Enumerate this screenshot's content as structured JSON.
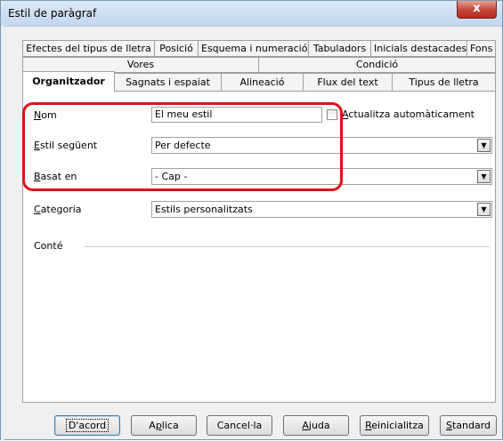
{
  "window": {
    "title": "Estil de paràgraf",
    "close_label": "x"
  },
  "tabs": {
    "row1": [
      "Efectes del tipus de lletra",
      "Posició",
      "Esquema i numeració",
      "Tabuladors",
      "Inicials destacades",
      "Fons"
    ],
    "row2": [
      "Vores",
      "Condició"
    ],
    "row3": [
      "Organitzador",
      "Sagnats i espaiat",
      "Alineació",
      "Flux del text",
      "Tipus de lletra"
    ],
    "active": "Organitzador"
  },
  "form": {
    "name_label_first": "N",
    "name_label_rest": "om",
    "name_value": "El meu estil",
    "autoupdate_label_first": "A",
    "autoupdate_label_rest": "ctualitza automàticament",
    "autoupdate_checked": false,
    "next_label_first": "E",
    "next_label_rest": "stil següent",
    "next_value": "Per defecte",
    "based_label_first": "B",
    "based_label_rest": "asat en",
    "based_value": "- Cap -",
    "category_label_first": "C",
    "category_label_rest": "ategoria",
    "category_value": "Estils personalitzats",
    "contains_label": "Conté"
  },
  "buttons": {
    "ok": "D'acord",
    "apply_first": "A",
    "apply_mid": "p",
    "apply_rest": "lica",
    "cancel": "Cancel·la",
    "help_first": "A",
    "help_mid": "j",
    "help_rest": "uda",
    "reset_first": "R",
    "reset_rest": "einicialitza",
    "standard_first": "S",
    "standard_rest": "tandard"
  },
  "icons": {
    "dropdown": "chevron-down-icon",
    "close": "close-icon"
  },
  "colors": {
    "highlight": "#e0101a",
    "close_button": "#c7443a"
  }
}
